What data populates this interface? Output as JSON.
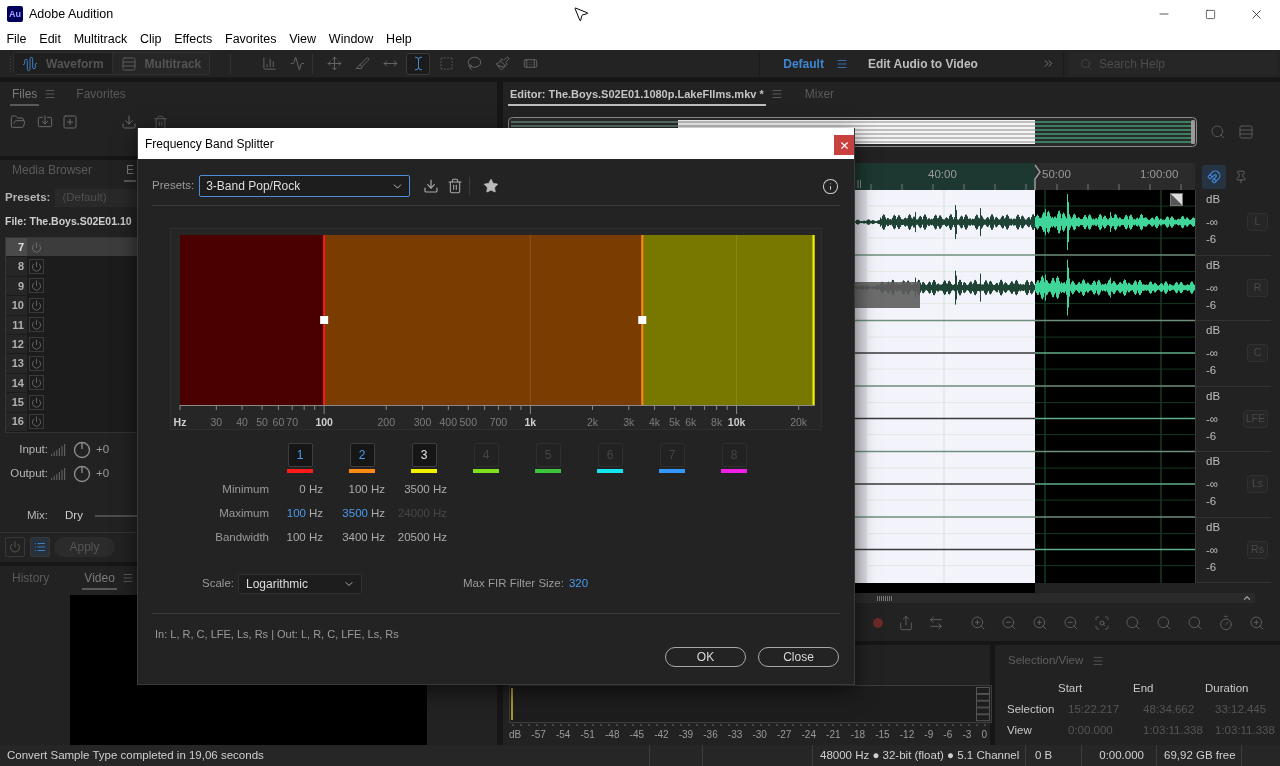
{
  "window": {
    "logo_text": "Au",
    "title": "Adobe Audition"
  },
  "menu": [
    "File",
    "Edit",
    "Multitrack",
    "Clip",
    "Effects",
    "Favorites",
    "View",
    "Window",
    "Help"
  ],
  "toolbar": {
    "views": [
      {
        "label": "Waveform",
        "selected": true
      },
      {
        "label": "Multitrack",
        "selected": false
      }
    ],
    "tool_groups": [
      [
        {
          "kind": "frequency",
          "selected": false
        },
        {
          "kind": "pitch",
          "selected": false
        }
      ],
      [
        {
          "kind": "move",
          "selected": false
        },
        {
          "kind": "razor",
          "selected": false
        },
        {
          "kind": "slip",
          "selected": false
        },
        {
          "kind": "time",
          "selected": true
        },
        {
          "kind": "marquee",
          "selected": false
        },
        {
          "kind": "lasso",
          "selected": false
        },
        {
          "kind": "brush",
          "selected": false
        },
        {
          "kind": "healing",
          "selected": false
        }
      ]
    ],
    "workspaces": [
      {
        "label": "Default",
        "selected": true
      },
      {
        "label": "Edit Audio to Video",
        "selected": false
      }
    ],
    "search": {
      "placeholder": "Search Help"
    }
  },
  "files_panel": {
    "tabs": [
      {
        "label": "Files",
        "selected": true
      },
      {
        "label": "Favorites",
        "selected": false
      }
    ]
  },
  "effects_panel": {
    "tabs": [
      {
        "label": "Media Browser",
        "selected": false
      },
      {
        "label": "E",
        "selected": true
      }
    ],
    "presets": {
      "label": "Presets:",
      "value": "(Default)"
    },
    "file": "File: The.Boys.S02E01.10",
    "slots": [
      {
        "number": "7",
        "selected": true
      },
      {
        "number": "8",
        "selected": false
      },
      {
        "number": "9",
        "selected": false
      },
      {
        "number": "10",
        "selected": false
      },
      {
        "number": "11",
        "selected": false
      },
      {
        "number": "12",
        "selected": false
      },
      {
        "number": "13",
        "selected": false
      },
      {
        "number": "14",
        "selected": false
      },
      {
        "number": "15",
        "selected": false
      },
      {
        "number": "16",
        "selected": false
      }
    ],
    "input": {
      "label": "Input:",
      "value": "+0"
    },
    "output": {
      "label": "Output:",
      "value": "+0"
    },
    "mix": {
      "label": "Mix:",
      "value": "Dry"
    },
    "apply": "Apply"
  },
  "video_panel": {
    "tabs": [
      {
        "label": "History",
        "selected": false
      },
      {
        "label": "Video",
        "selected": true
      }
    ]
  },
  "editor": {
    "tabs": [
      {
        "label": "Editor: The.Boys.S02E01.1080p.LakeFIlms.mkv *",
        "selected": true
      },
      {
        "label": "Mixer",
        "selected": false
      }
    ],
    "ruler_labels": [
      "40:00",
      "50:00",
      "1:00:00"
    ],
    "channels": [
      {
        "label": "L",
        "unit": "dB",
        "center": "-∞",
        "lower": "-6"
      },
      {
        "label": "R",
        "unit": "dB",
        "center": "-∞",
        "lower": "-6"
      },
      {
        "label": "C",
        "unit": "dB",
        "center": "-∞",
        "lower": "-6"
      },
      {
        "label": "LFE",
        "unit": "dB",
        "center": "-∞",
        "lower": "-6"
      },
      {
        "label": "Ls",
        "unit": "dB",
        "center": "-∞",
        "lower": "-6"
      },
      {
        "label": "Rs",
        "unit": "dB",
        "center": "-∞",
        "lower": "-6"
      }
    ]
  },
  "levels": {
    "scale": [
      "dB",
      "-57",
      "-54",
      "-51",
      "-48",
      "-45",
      "-42",
      "-39",
      "-36",
      "-33",
      "-30",
      "-27",
      "-24",
      "-21",
      "-18",
      "-15",
      "-12",
      "-9",
      "-6",
      "-3",
      "0"
    ]
  },
  "selection_view": {
    "title": "Selection/View",
    "columns": [
      "Start",
      "End",
      "Duration"
    ],
    "rows": [
      {
        "label": "Selection",
        "values": [
          "15:22.217",
          "48:34.662",
          "33:12.445"
        ]
      },
      {
        "label": "View",
        "values": [
          "0:00.000",
          "1:03:11.338",
          "1:03:11.338"
        ]
      }
    ]
  },
  "dialog": {
    "title": "Frequency Band Splitter",
    "presets": {
      "label": "Presets:",
      "value": "3-Band Pop/Rock"
    },
    "band_display": {
      "regions": [
        {
          "color": "#4a0000"
        },
        {
          "color": "#7a3c00"
        },
        {
          "color": "#787800"
        }
      ],
      "crossovers": [
        {
          "level": 0.227
        },
        {
          "level": 0.728
        }
      ],
      "axis_labels": [
        "Hz",
        "30",
        "40",
        "50",
        "60",
        "70",
        "100",
        "200",
        "300",
        "400",
        "500",
        "700",
        "1k",
        "2k",
        "3k",
        "4k",
        "5k",
        "6k",
        "8k",
        "10k",
        "20k"
      ]
    },
    "row_labels": [
      "Minimum",
      "Maximum",
      "Bandwidth"
    ],
    "bands": [
      {
        "label": "1",
        "color": "#ff1a1a",
        "enabled": true,
        "adjustable": true,
        "minimum": "0 Hz",
        "maximum": {
          "value": "100",
          "unit": "Hz"
        },
        "bandwidth": "100 Hz"
      },
      {
        "label": "2",
        "color": "#ff8a14",
        "enabled": true,
        "adjustable": true,
        "minimum": "100 Hz",
        "maximum": {
          "value": "3500",
          "unit": "Hz"
        },
        "bandwidth": "3400 Hz"
      },
      {
        "label": "3",
        "color": "#f2f200",
        "enabled": true,
        "adjustable": false,
        "minimum": "3500 Hz",
        "maximum": {
          "value": "24000",
          "unit": "Hz"
        },
        "bandwidth": "20500 Hz"
      },
      {
        "label": "4",
        "color": "#80e01e",
        "enabled": false,
        "adjustable": false
      },
      {
        "label": "5",
        "color": "#3cc43c",
        "enabled": false,
        "adjustable": false
      },
      {
        "label": "6",
        "color": "#14e6f0",
        "enabled": false,
        "adjustable": false
      },
      {
        "label": "7",
        "color": "#3399ff",
        "enabled": false,
        "adjustable": false
      },
      {
        "label": "8",
        "color": "#f01ee6",
        "enabled": false,
        "adjustable": false
      }
    ],
    "scale": {
      "label": "Scale:",
      "value": "Logarithmic"
    },
    "fir": {
      "label": "Max FIR Filter Size:",
      "value": "320"
    },
    "routing": "In: L, R, C, LFE, Ls, Rs | Out: L, R, C, LFE, Ls, Rs",
    "buttons": [
      "OK",
      "Close"
    ]
  },
  "status_bar": {
    "message": "Convert Sample Type completed in 19,06 seconds",
    "format": "48000 Hz ● 32-bit (float) ● 5.1 Channel",
    "size": "0 B",
    "time": "0:00.000",
    "free": "69,92 GB free"
  }
}
